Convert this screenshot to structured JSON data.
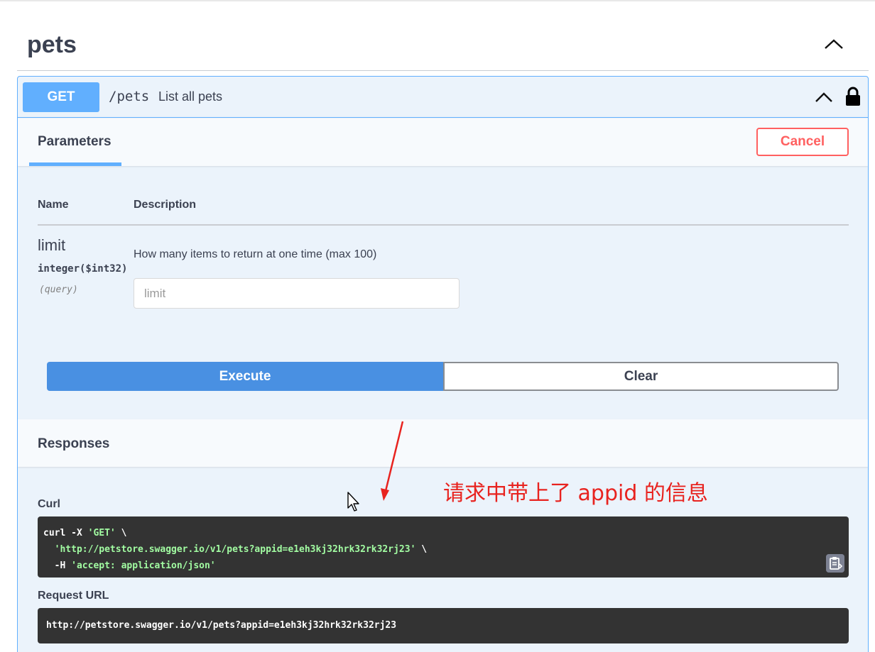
{
  "tag": {
    "title": "pets"
  },
  "operation": {
    "method": "GET",
    "path": "/pets",
    "summary": "List all pets"
  },
  "parameters_tab": {
    "label": "Parameters",
    "cancel_label": "Cancel"
  },
  "param_table": {
    "headers": {
      "name": "Name",
      "description": "Description"
    },
    "rows": [
      {
        "name": "limit",
        "type": "integer($int32)",
        "in": "(query)",
        "description": "How many items to return at one time (max 100)",
        "placeholder": "limit"
      }
    ]
  },
  "actions": {
    "execute_label": "Execute",
    "clear_label": "Clear"
  },
  "responses": {
    "title": "Responses",
    "curl_label": "Curl",
    "curl": {
      "line1_cmd": "curl -X ",
      "line1_str": "'GET'",
      "line1_end": " \\",
      "line2_indent": "  ",
      "line2_str": "'http://petstore.swagger.io/v1/pets?appid=e1eh3kj32hrk32rk32rj23'",
      "line2_end": " \\",
      "line3_cmd": "  -H ",
      "line3_str": "'accept: application/json'"
    },
    "request_url_label": "Request URL",
    "request_url": "http://petstore.swagger.io/v1/pets?appid=e1eh3kj32hrk32rk32rj23"
  },
  "annotation": {
    "text": "请求中带上了 appid 的信息",
    "color": "#e8231f"
  },
  "colors": {
    "get_blue": "#61affe",
    "execute_blue": "#4990e2",
    "cancel_red": "#ff6060",
    "code_bg": "#333333",
    "string_green": "#a2fca2"
  },
  "icons": {
    "tag_toggle": "chevron-up-icon",
    "op_toggle": "chevron-up-icon",
    "lock": "lock-icon",
    "copy": "clipboard-copy-icon",
    "cursor": "mouse-pointer-icon",
    "arrow": "red-arrow-icon"
  }
}
